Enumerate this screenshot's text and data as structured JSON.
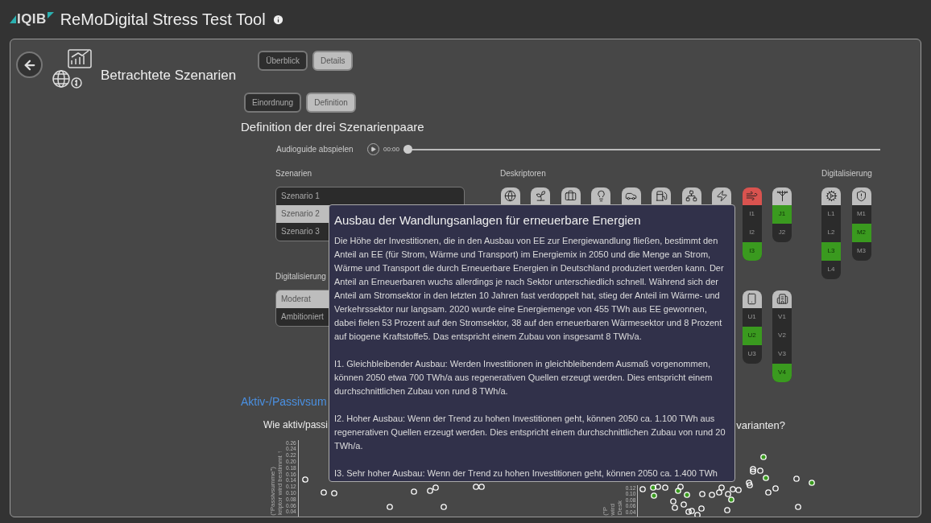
{
  "header": {
    "logo": "IQIB",
    "title": "ReMoDigital Stress Test Tool"
  },
  "page": {
    "title": "Betrachtete Szenarien",
    "view_tabs": [
      {
        "label": "Überblick",
        "selected": false
      },
      {
        "label": "Details",
        "selected": true
      }
    ],
    "section_tabs": [
      {
        "label": "Einordnung",
        "selected": false
      },
      {
        "label": "Definition",
        "selected": true
      }
    ],
    "heading": "Definition der drei Szenarienpaare"
  },
  "audio": {
    "label": "Audioguide abspielen",
    "time": "00:00",
    "level": 0
  },
  "scenarios": {
    "label": "Szenarien",
    "items": [
      {
        "label": "Szenario 1",
        "selected": false
      },
      {
        "label": "Szenario 2",
        "selected": true
      },
      {
        "label": "Szenario 3",
        "selected": false
      }
    ]
  },
  "digitalization_levels": {
    "label": "Digitalisierung",
    "items": [
      {
        "label": "Moderat",
        "selected": true
      },
      {
        "label": "Ambitioniert",
        "selected": false
      }
    ]
  },
  "descriptors": {
    "label": "Deskriptoren",
    "rows": [
      [
        {
          "highlighted": false
        },
        {
          "highlighted": false
        },
        {
          "highlighted": false
        },
        {
          "highlighted": false
        },
        {
          "highlighted": false
        },
        {
          "highlighted": false
        },
        {
          "highlighted": false
        },
        {
          "highlighted": false
        },
        {
          "highlighted": true,
          "levels": [
            {
              "label": "I1",
              "selected": false
            },
            {
              "label": "I2",
              "selected": false
            },
            {
              "label": "I3",
              "selected": true
            }
          ]
        },
        {
          "highlighted": false,
          "levels": [
            {
              "label": "J1",
              "selected": true
            },
            {
              "label": "J2",
              "selected": false
            }
          ]
        }
      ],
      [
        {
          "highlighted": false,
          "levels": [
            {
              "label": "U1",
              "selected": false
            },
            {
              "label": "U2",
              "selected": true
            },
            {
              "label": "U3",
              "selected": false
            }
          ]
        },
        {
          "highlighted": false,
          "levels": [
            {
              "label": "V1",
              "selected": false
            },
            {
              "label": "V2",
              "selected": false
            },
            {
              "label": "V3",
              "selected": false
            },
            {
              "label": "V4",
              "selected": true
            }
          ]
        }
      ]
    ]
  },
  "digital_descriptors": {
    "label": "Digitalisierung",
    "columns": [
      {
        "highlighted": false,
        "levels": [
          {
            "label": "L1",
            "selected": false
          },
          {
            "label": "L2",
            "selected": false
          },
          {
            "label": "L3",
            "selected": true
          },
          {
            "label": "L4",
            "selected": false
          }
        ]
      },
      {
        "highlighted": false,
        "levels": [
          {
            "label": "M1",
            "selected": false
          },
          {
            "label": "M2",
            "selected": true
          },
          {
            "label": "M3",
            "selected": false
          }
        ]
      }
    ]
  },
  "tooltip": {
    "title": "Ausbau der Wandlungsanlagen für erneuerbare Energien",
    "paragraphs": [
      "Die Höhe der Investitionen, die in den Ausbau von EE zur Energiewandlung fließen, bestimmt den Anteil an EE (für Strom, Wärme und Transport) im Energiemix in 2050 und die Menge an Strom, Wärme und Transport die durch Erneuerbare Energien in Deutschland produziert werden kann. Der Anteil an Erneuerbaren wuchs allerdings je nach Sektor unterschiedlich schnell. Während sich der Anteil am Stromsektor in den letzten 10 Jahren fast verdoppelt hat, stieg der Anteil im Wärme- und Verkehrssektor nur langsam. 2020 wurde eine Energiemenge von 455 TWh aus EE gewonnen, dabei fielen 53 Prozent auf den Stromsektor, 38 auf den erneuerbaren Wärmesektor und 8 Prozent auf biogene Kraftstoffe5. Das entspricht einem Zubau von insgesamt 8 TWh/a.",
      "I1. Gleichbleibender Ausbau: Werden Investitionen in gleichbleibendem Ausmaß vorgenommen, können 2050 etwa 700 TWh/a aus regenerativen Quellen erzeugt werden. Dies entspricht einem durchschnittlichen Zubau von rund 8 TWh/a.",
      "I2. Hoher Ausbau: Wenn der Trend zu hohen Investitionen geht, können 2050 ca. 1.100 TWh aus regenerativen Quellen erzeugt werden. Dies entspricht einem durchschnittlichen Zubau von rund 20 TWh/a.",
      "I3. Sehr hoher Ausbau: Wenn der Trend zu hohen Investitionen geht, können 2050 ca. 1.400 TWh"
    ]
  },
  "analysis": {
    "heading": "Aktiv-/Passivsum",
    "question_start": "Wie aktiv/passi",
    "question_end": "varianten?",
    "charts": [
      {
        "axis_label_lines": [
          "kriptor wird bestimmt ↑",
          "(\"Passivsumme\")"
        ],
        "tick_labels": [
          "0.26",
          "0.24",
          "0.22",
          "0.20",
          "0.18",
          "0.16",
          "0.14",
          "0.12",
          "0.10",
          "0.08",
          "0.06",
          "0.04"
        ]
      },
      {
        "axis_label_lines": [
          "Desk",
          "wird",
          "(\"P"
        ],
        "tick_labels": [
          "0.12",
          "0.10",
          "0.08",
          "0.06",
          "0.04"
        ]
      }
    ]
  }
}
